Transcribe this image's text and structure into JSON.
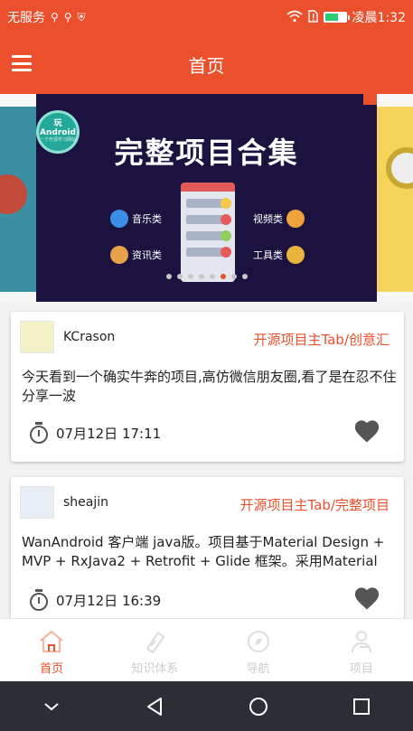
{
  "status_bar": {
    "carrier": "无服务",
    "time": "凌晨1:32"
  },
  "app_bar": {
    "title": "首页"
  },
  "banner": {
    "title": "完整项目合集",
    "badge_line1": "玩",
    "badge_line2": "Android",
    "badge_line3": "一个开源学习网站",
    "categories": {
      "music": "音乐类",
      "info": "资讯类",
      "video": "视频类",
      "tools": "工具类"
    },
    "indicator_count": 8,
    "indicator_active": 5
  },
  "articles": [
    {
      "author": "KCrason",
      "category": "开源项目主Tab/创意汇",
      "description": "今天看到一个确实牛奔的项目,高仿微信朋友圈,看了是在忍不住分享一波",
      "time": "07月12日 17:11"
    },
    {
      "author": "sheajin",
      "category": "开源项目主Tab/完整项目",
      "description": "WanAndroid 客户端 java版。项目基于Material Design + MVP + RxJava2 + Retrofit + Glide 框架。采用Material",
      "time": "07月12日 16:39"
    }
  ],
  "bottom_nav": [
    {
      "label": "首页",
      "icon": "home-icon",
      "active": true
    },
    {
      "label": "知识体系",
      "icon": "knowledge-icon",
      "active": false
    },
    {
      "label": "导航",
      "icon": "navigation-icon",
      "active": false
    },
    {
      "label": "项目",
      "icon": "project-icon",
      "active": false
    }
  ],
  "colors": {
    "accent": "#e9502b",
    "inactive": "#cccccc",
    "banner_bg": "#1c1240"
  }
}
